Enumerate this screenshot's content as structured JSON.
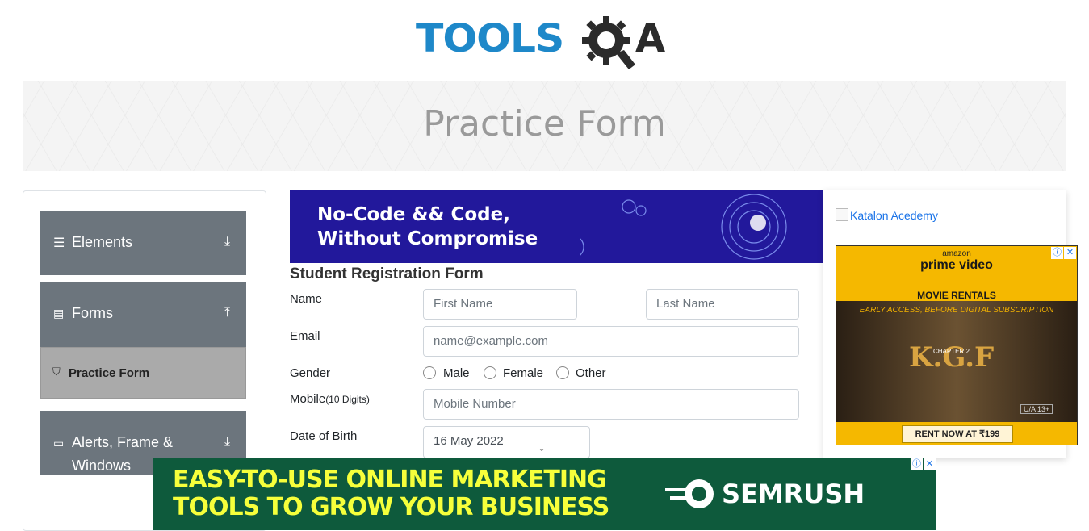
{
  "brand": {
    "part1": "TOOLS",
    "part2": "QA",
    "tools_color": "#1e88c9",
    "qa_color": "#2b2b2b"
  },
  "page_title": "Practice Form",
  "sidebar": {
    "groups": [
      {
        "label": "Elements",
        "icon": "hamburger-icon",
        "arrow": "download-arrow-icon"
      },
      {
        "label": "Forms",
        "icon": "document-icon",
        "arrow": "upload-arrow-icon"
      },
      {
        "label": "Alerts, Frame &",
        "label2": "Windows",
        "icon": "window-icon",
        "arrow": "download-arrow-icon"
      }
    ],
    "active_item": {
      "label": "Practice Form",
      "icon": "html5-icon"
    }
  },
  "top_ad": {
    "line1": "No-Code && Code,",
    "line2": "Without Compromise"
  },
  "form": {
    "title": "Student Registration Form",
    "name_label": "Name",
    "first_name_placeholder": "First Name",
    "last_name_placeholder": "Last Name",
    "email_label": "Email",
    "email_placeholder": "name@example.com",
    "gender_label": "Gender",
    "gender_options": [
      "Male",
      "Female",
      "Other"
    ],
    "mobile_label": "Mobile",
    "mobile_hint": "(10 Digits)",
    "mobile_placeholder": "Mobile Number",
    "dob_label": "Date of Birth",
    "dob_value": "16 May 2022"
  },
  "right_ads": {
    "katalon_alt": "Katalon Acedemy",
    "prime": {
      "amazon": "amazon",
      "prime_video": "prime video",
      "movie_rentals": "MOVIE RENTALS",
      "early_access": "EARLY ACCESS, BEFORE DIGITAL SUBSCRIPTION",
      "movie_title": "K.G.F",
      "chapter": "CHAPTER 2",
      "rating": "U/A 13+",
      "cta": "RENT NOW AT ₹199"
    }
  },
  "bottom_ad": {
    "line1": "EASY-TO-USE ONLINE MARKETING",
    "line2": "TOOLS TO GROW YOUR BUSINESS",
    "brand": "SEMRUSH"
  },
  "ad_badges": {
    "info": "ⓘ",
    "close": "✕"
  }
}
